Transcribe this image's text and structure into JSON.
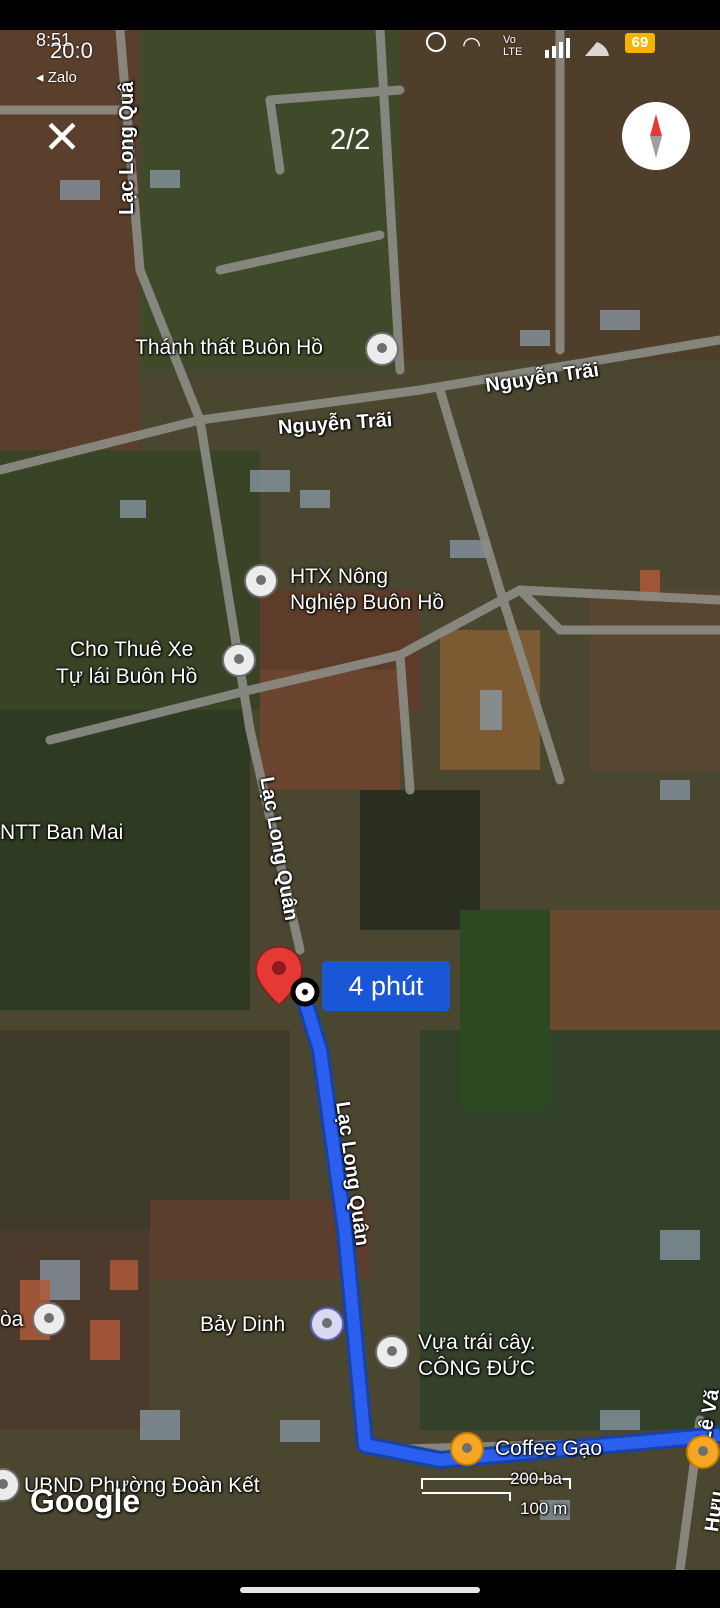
{
  "status_bar": {
    "time": "8:51",
    "overlay_text": "20:0",
    "network_label": "Vo LTE",
    "battery": "69",
    "back_app_label": "◂ Zalo"
  },
  "viewer": {
    "page_counter": "2/2",
    "close_label": "✕"
  },
  "map": {
    "route_duration": "4 phút",
    "scale_label_top": "200 ba",
    "scale_label_bottom": "100 m",
    "logo_text": "Google",
    "road_labels": {
      "lac_long_quan_top": "Lạc Long Quâ",
      "nguyen_trai_1": "Nguyễn Trãi",
      "nguyen_trai_2": "Nguyễn Trãi",
      "lac_long_quan_mid": "Lạc Long Quân",
      "lac_long_quan_route": "Lạc Long Quân",
      "le_van": "Lê Vă",
      "huu": "Hưu"
    },
    "places": {
      "thanh_that": "Thánh thất Buôn Hồ",
      "htx_line1": "HTX Nông",
      "htx_line2": "Nghiệp Buôn Hồ",
      "cho_thue_line1": "Cho Thuê Xe",
      "cho_thue_line2": "Tự lái Buôn Hồ",
      "ntt_ban_mai": "NTT Ban Mai",
      "bay_dinh": "Bảy Dinh",
      "vua_trai_cay_line1": "Vựa trái cây.",
      "vua_trai_cay_line2": "CÔNG ĐỨC",
      "coffee_gao": "Coffee Gạo",
      "ubnd": "UBND Phường Đoàn Kết",
      "hoa_partial": "òa"
    },
    "colors": {
      "route": "#1a57d6",
      "destination_pin": "#e53935"
    }
  }
}
